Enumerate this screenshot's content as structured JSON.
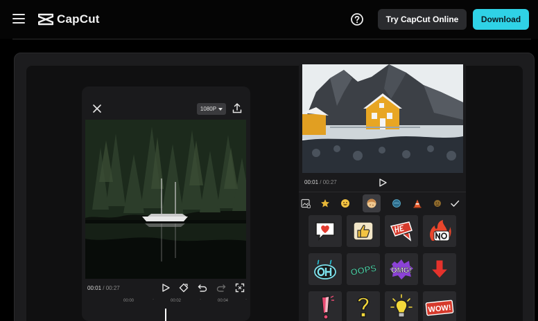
{
  "header": {
    "brand": "CapCut",
    "try_online_label": "Try CapCut Online",
    "download_label": "Download"
  },
  "editor": {
    "resolution": "1080P",
    "current_time": "00:01",
    "total_time": "/ 00:27",
    "ruler_ticks": [
      "00:00",
      "00:02",
      "00:04"
    ]
  },
  "preview": {
    "current_time": "00:01",
    "total_time": "/ 00:27"
  },
  "sticker_categories": [
    {
      "icon": "image-sticker-icon"
    },
    {
      "icon": "star-icon"
    },
    {
      "icon": "emoji-icon"
    },
    {
      "icon": "cookie-icon",
      "active": true
    },
    {
      "icon": "planet-icon"
    },
    {
      "icon": "cone-icon"
    },
    {
      "icon": "face-icon"
    },
    {
      "icon": "check-icon"
    }
  ],
  "stickers": {
    "row2": [
      "OOPS",
      "OMG!"
    ],
    "row3": [
      "WOW!"
    ]
  },
  "colors": {
    "accent": "#2fd2e6",
    "panel": "#1a1a1c",
    "stage": "#1c1c1e"
  }
}
